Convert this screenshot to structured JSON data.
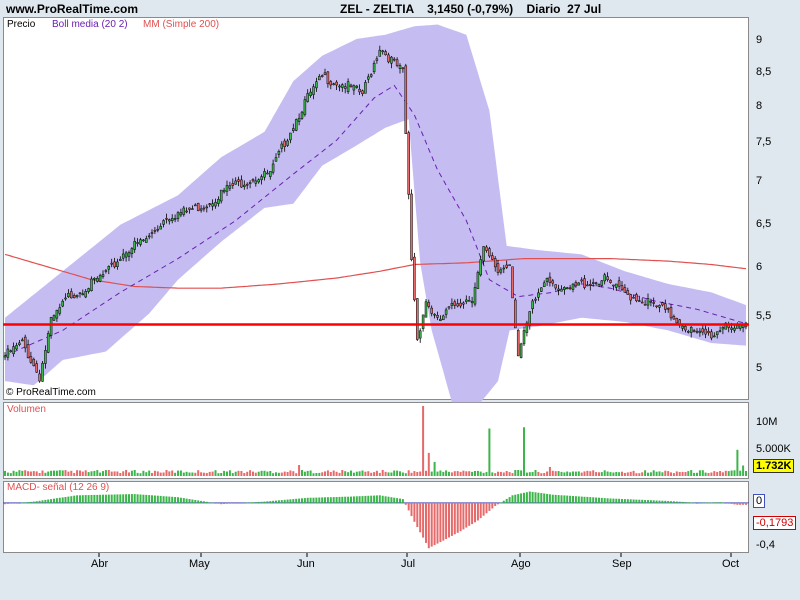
{
  "header": {
    "site": "www.ProRealTime.com",
    "title": "ZEL - ZELTIA    3,1450 (-0,79%)    Diario  27 Jul"
  },
  "price_panel": {
    "label": "Precio",
    "legend_boll": "Boll media (20 2)",
    "legend_mm": "MM (Simple 200)",
    "copyright": "© ProRealTime.com",
    "y_ticks": [
      "9",
      "8,5",
      "8",
      "7,5",
      "7",
      "6,5",
      "6",
      "5,5",
      "5"
    ]
  },
  "volume_panel": {
    "label": "Volumen",
    "y_ticks": [
      "10M",
      "5.000K"
    ],
    "current": "1.732K"
  },
  "macd_panel": {
    "label": "MACD- señal (12 26 9)",
    "y_ticks": [
      "0",
      "-0,4"
    ],
    "current": "-0,1793"
  },
  "x_ticks": [
    "Abr",
    "May",
    "Jun",
    "Jul",
    "Ago",
    "Sep",
    "Oct"
  ],
  "colors": {
    "up": "#3cb54a",
    "down": "#e66a6a",
    "band": "#c5bdf2",
    "mm": "#e05050",
    "support": "#ff0000",
    "basis": "#6a1fb0",
    "macd_zero": "#3f4fbf"
  },
  "chart_data": {
    "type": "candlestick",
    "title": "ZEL - ZELTIA",
    "ylim": [
      4.8,
      9.25
    ],
    "support_level": 5.67,
    "x_labels": [
      "Abr",
      "May",
      "Jun",
      "Jul",
      "Ago",
      "Sep",
      "Oct"
    ],
    "close_path": [
      [
        0,
        5.3
      ],
      [
        6,
        5.45
      ],
      [
        12,
        5.05
      ],
      [
        16,
        5.7
      ],
      [
        22,
        6.0
      ],
      [
        30,
        6.15
      ],
      [
        36,
        6.3
      ],
      [
        42,
        6.55
      ],
      [
        50,
        6.7
      ],
      [
        56,
        6.95
      ],
      [
        62,
        7.0
      ],
      [
        70,
        7.1
      ],
      [
        78,
        7.3
      ],
      [
        86,
        7.4
      ],
      [
        92,
        7.45
      ],
      [
        98,
        7.9
      ],
      [
        104,
        8.3
      ],
      [
        110,
        8.6
      ],
      [
        118,
        8.5
      ],
      [
        124,
        8.4
      ],
      [
        130,
        8.95
      ],
      [
        138,
        8.65
      ],
      [
        141,
        6.45
      ],
      [
        143,
        5.5
      ],
      [
        146,
        5.95
      ],
      [
        150,
        5.7
      ],
      [
        156,
        5.9
      ],
      [
        162,
        6.0
      ],
      [
        166,
        6.55
      ],
      [
        171,
        6.3
      ],
      [
        175,
        6.4
      ],
      [
        178,
        5.3
      ],
      [
        183,
        5.9
      ],
      [
        188,
        6.25
      ],
      [
        194,
        6.05
      ],
      [
        200,
        6.15
      ],
      [
        208,
        6.2
      ],
      [
        214,
        6.05
      ],
      [
        222,
        5.95
      ],
      [
        228,
        5.85
      ],
      [
        234,
        5.7
      ],
      [
        240,
        5.55
      ],
      [
        246,
        5.55
      ],
      [
        250,
        5.7
      ],
      [
        254,
        5.6
      ],
      [
        257,
        5.62
      ]
    ],
    "boll_upper": [
      [
        0,
        5.75
      ],
      [
        20,
        6.3
      ],
      [
        40,
        6.85
      ],
      [
        60,
        7.2
      ],
      [
        75,
        7.65
      ],
      [
        90,
        7.95
      ],
      [
        100,
        8.55
      ],
      [
        110,
        8.85
      ],
      [
        122,
        9.05
      ],
      [
        132,
        9.1
      ],
      [
        142,
        9.2
      ],
      [
        150,
        9.22
      ],
      [
        160,
        9.1
      ],
      [
        168,
        8.2
      ],
      [
        174,
        6.6
      ],
      [
        185,
        6.55
      ],
      [
        200,
        6.5
      ],
      [
        215,
        6.3
      ],
      [
        230,
        6.15
      ],
      [
        245,
        6.05
      ],
      [
        257,
        5.9
      ]
    ],
    "boll_lower": [
      [
        0,
        5.0
      ],
      [
        10,
        4.95
      ],
      [
        20,
        5.25
      ],
      [
        35,
        5.35
      ],
      [
        50,
        5.8
      ],
      [
        60,
        6.2
      ],
      [
        75,
        6.65
      ],
      [
        90,
        7.05
      ],
      [
        100,
        7.1
      ],
      [
        110,
        7.55
      ],
      [
        120,
        7.75
      ],
      [
        132,
        8.0
      ],
      [
        140,
        8.1
      ],
      [
        144,
        6.4
      ],
      [
        148,
        5.6
      ],
      [
        155,
        4.75
      ],
      [
        165,
        4.75
      ],
      [
        171,
        5.0
      ],
      [
        175,
        5.6
      ],
      [
        185,
        5.65
      ],
      [
        200,
        5.75
      ],
      [
        215,
        5.7
      ],
      [
        230,
        5.6
      ],
      [
        245,
        5.45
      ],
      [
        257,
        5.42
      ]
    ],
    "boll_basis": [
      [
        0,
        5.3
      ],
      [
        20,
        5.6
      ],
      [
        40,
        6.05
      ],
      [
        60,
        6.45
      ],
      [
        80,
        6.9
      ],
      [
        100,
        7.45
      ],
      [
        115,
        7.85
      ],
      [
        128,
        8.35
      ],
      [
        135,
        8.5
      ],
      [
        142,
        8.15
      ],
      [
        150,
        7.5
      ],
      [
        160,
        6.9
      ],
      [
        168,
        6.2
      ],
      [
        178,
        6.0
      ],
      [
        190,
        6.05
      ],
      [
        200,
        6.15
      ],
      [
        210,
        6.1
      ],
      [
        225,
        5.95
      ],
      [
        240,
        5.85
      ],
      [
        250,
        5.75
      ],
      [
        257,
        5.68
      ]
    ],
    "mm200": [
      [
        0,
        6.5
      ],
      [
        15,
        6.35
      ],
      [
        30,
        6.2
      ],
      [
        45,
        6.12
      ],
      [
        60,
        6.1
      ],
      [
        75,
        6.1
      ],
      [
        95,
        6.15
      ],
      [
        115,
        6.22
      ],
      [
        130,
        6.3
      ],
      [
        142,
        6.38
      ],
      [
        160,
        6.4
      ],
      [
        180,
        6.45
      ],
      [
        195,
        6.45
      ],
      [
        210,
        6.45
      ],
      [
        230,
        6.42
      ],
      [
        245,
        6.38
      ],
      [
        257,
        6.33
      ]
    ],
    "volume": {
      "ylim": [
        0,
        11500000
      ],
      "spikes": [
        [
          102,
          1800000
        ],
        [
          145,
          11500000
        ],
        [
          147,
          3800000
        ],
        [
          149,
          2300000
        ],
        [
          168,
          7800000
        ],
        [
          180,
          8000000
        ],
        [
          189,
          1500000
        ],
        [
          254,
          4300000
        ],
        [
          256,
          1732000
        ]
      ]
    },
    "macd": {
      "ylim": [
        -0.75,
        0.3
      ],
      "series": [
        [
          0,
          -0.02
        ],
        [
          10,
          0.02
        ],
        [
          25,
          0.12
        ],
        [
          45,
          0.14
        ],
        [
          60,
          0.09
        ],
        [
          75,
          -0.02
        ],
        [
          90,
          0.02
        ],
        [
          105,
          0.08
        ],
        [
          120,
          0.1
        ],
        [
          130,
          0.12
        ],
        [
          138,
          0.06
        ],
        [
          142,
          -0.3
        ],
        [
          147,
          -0.72
        ],
        [
          152,
          -0.6
        ],
        [
          158,
          -0.45
        ],
        [
          164,
          -0.28
        ],
        [
          170,
          -0.05
        ],
        [
          176,
          0.12
        ],
        [
          182,
          0.18
        ],
        [
          190,
          0.13
        ],
        [
          200,
          0.1
        ],
        [
          210,
          0.07
        ],
        [
          220,
          0.05
        ],
        [
          230,
          0.03
        ],
        [
          240,
          0.0
        ],
        [
          248,
          0.01
        ],
        [
          254,
          -0.03
        ],
        [
          257,
          -0.03
        ]
      ]
    }
  }
}
